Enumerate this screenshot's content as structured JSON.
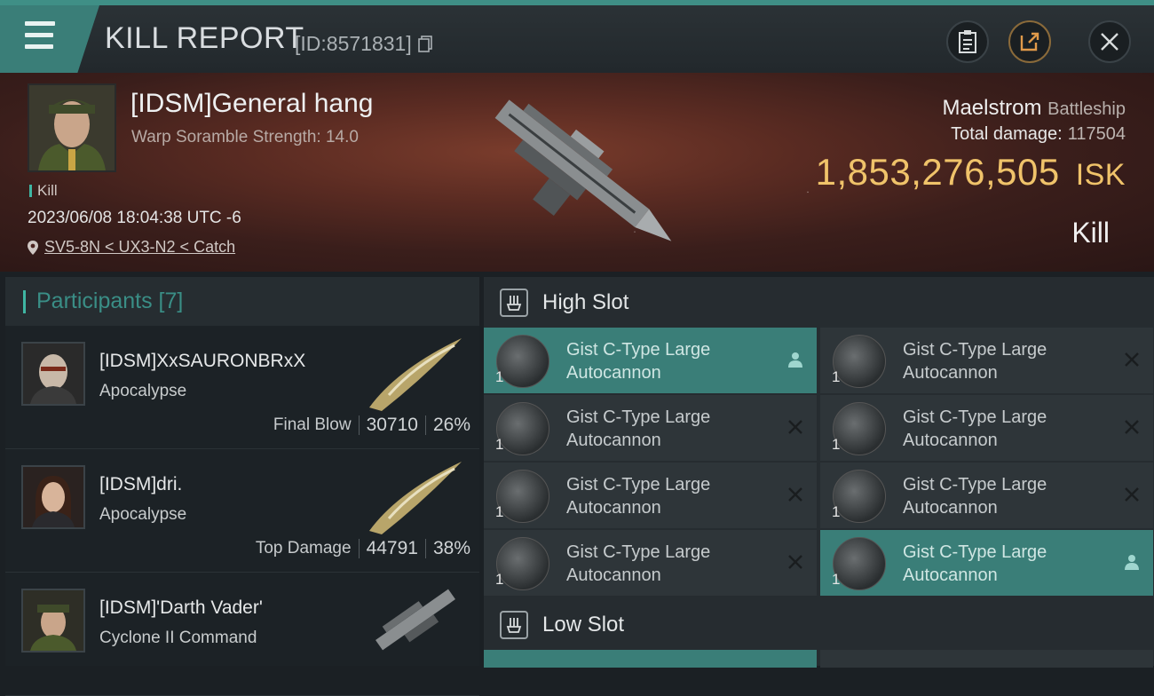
{
  "header": {
    "title": "KILL REPORT",
    "id_text": "[ID:8571831]"
  },
  "victim": {
    "name": "[IDSM]General hang",
    "warp": "Warp Soramble Strength: 14.0",
    "tag": "Kill",
    "datetime": "2023/06/08 18:04:38 UTC -6",
    "location": "SV5-8N < UX3-N2 < Catch",
    "ship": "Maelstrom",
    "ship_class": "Battleship",
    "total_damage_label": "Total damage:",
    "total_damage": "117504",
    "isk_value": "1,853,276,505",
    "isk_unit": "ISK",
    "result": "Kill"
  },
  "participants": {
    "title": "Participants [7]",
    "rows": [
      {
        "name": "[IDSM]XxSAURONBRxX",
        "ship": "Apocalypse",
        "label": "Final Blow",
        "damage": "30710",
        "pct": "26%"
      },
      {
        "name": "[IDSM]dri.",
        "ship": "Apocalypse",
        "label": "Top Damage",
        "damage": "44791",
        "pct": "38%"
      },
      {
        "name": "[IDSM]'Darth Vader'",
        "ship": "Cyclone II Command",
        "label": "",
        "damage": "",
        "pct": ""
      }
    ]
  },
  "slots": {
    "high_title": "High Slot",
    "low_title": "Low Slot",
    "items": [
      {
        "name": "Gist C-Type Large Autocannon",
        "qty": "1",
        "status": "person-icon",
        "active": true
      },
      {
        "name": "Gist C-Type Large Autocannon",
        "qty": "1",
        "status": "cross-icon",
        "active": false
      },
      {
        "name": "Gist C-Type Large Autocannon",
        "qty": "1",
        "status": "cross-icon",
        "active": false
      },
      {
        "name": "Gist C-Type Large Autocannon",
        "qty": "1",
        "status": "cross-icon",
        "active": false
      },
      {
        "name": "Gist C-Type Large Autocannon",
        "qty": "1",
        "status": "cross-icon",
        "active": false
      },
      {
        "name": "Gist C-Type Large Autocannon",
        "qty": "1",
        "status": "cross-icon",
        "active": false
      },
      {
        "name": "Gist C-Type Large Autocannon",
        "qty": "1",
        "status": "cross-icon",
        "active": false
      },
      {
        "name": "Gist C-Type Large Autocannon",
        "qty": "1",
        "status": "person-icon",
        "active": true
      }
    ]
  },
  "colors": {
    "accent": "#3a7e78",
    "isk": "#f0c36a",
    "teal_text": "#3a8e86"
  }
}
